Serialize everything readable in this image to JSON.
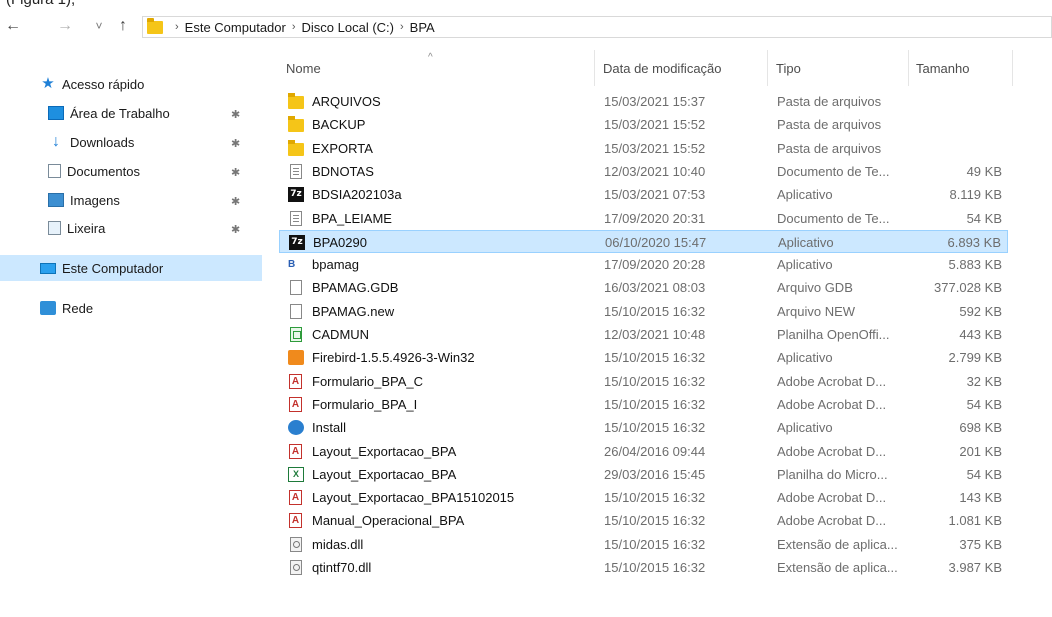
{
  "top_text": "(Figura 1),",
  "nav": {
    "back": "←",
    "forward": "→",
    "recent": "˅",
    "up": "↑",
    "breadcrumb": [
      "Este Computador",
      "Disco Local (C:)",
      "BPA"
    ]
  },
  "sidebar": {
    "items": [
      {
        "label": "Acesso rápido",
        "icon": "star-icon"
      },
      {
        "label": "Área de Trabalho",
        "icon": "desktop-icon",
        "pinned": true
      },
      {
        "label": "Downloads",
        "icon": "download-icon",
        "pinned": true
      },
      {
        "label": "Documentos",
        "icon": "documents-icon",
        "pinned": true
      },
      {
        "label": "Imagens",
        "icon": "images-icon",
        "pinned": true
      },
      {
        "label": "Lixeira",
        "icon": "recycle-bin-icon",
        "pinned": true
      },
      {
        "label": "Este Computador",
        "icon": "computer-icon",
        "selected": true
      },
      {
        "label": "Rede",
        "icon": "network-icon"
      }
    ],
    "pin_glyph": "📌"
  },
  "columns": {
    "name": "Nome",
    "date": "Data de modificação",
    "type": "Tipo",
    "size": "Tamanho",
    "sort_indicator": "^"
  },
  "files": [
    {
      "name": "ARQUIVOS",
      "date": "15/03/2021 15:37",
      "type": "Pasta de arquivos",
      "size": "",
      "icon": "folder-icon"
    },
    {
      "name": "BACKUP",
      "date": "15/03/2021 15:52",
      "type": "Pasta de arquivos",
      "size": "",
      "icon": "folder-icon"
    },
    {
      "name": "EXPORTA",
      "date": "15/03/2021 15:52",
      "type": "Pasta de arquivos",
      "size": "",
      "icon": "folder-icon"
    },
    {
      "name": "BDNOTAS",
      "date": "12/03/2021 10:40",
      "type": "Documento de Te...",
      "size": "49 KB",
      "icon": "text-file-icon"
    },
    {
      "name": "BDSIA202103a",
      "date": "15/03/2021 07:53",
      "type": "Aplicativo",
      "size": "8.119 KB",
      "icon": "7zip-icon"
    },
    {
      "name": "BPA_LEIAME",
      "date": "17/09/2020 20:31",
      "type": "Documento de Te...",
      "size": "54 KB",
      "icon": "text-file-icon"
    },
    {
      "name": "BPA0290",
      "date": "06/10/2020 15:47",
      "type": "Aplicativo",
      "size": "6.893 KB",
      "icon": "7zip-icon",
      "selected": true
    },
    {
      "name": "bpamag",
      "date": "17/09/2020 20:28",
      "type": "Aplicativo",
      "size": "5.883 KB",
      "icon": "bpa-app-icon"
    },
    {
      "name": "BPAMAG.GDB",
      "date": "16/03/2021 08:03",
      "type": "Arquivo GDB",
      "size": "377.028 KB",
      "icon": "blank-file-icon"
    },
    {
      "name": "BPAMAG.new",
      "date": "15/10/2015 16:32",
      "type": "Arquivo NEW",
      "size": "592 KB",
      "icon": "blank-file-icon"
    },
    {
      "name": "CADMUN",
      "date": "12/03/2021 10:48",
      "type": "Planilha OpenOffi...",
      "size": "443 KB",
      "icon": "spreadsheet-icon"
    },
    {
      "name": "Firebird-1.5.5.4926-3-Win32",
      "date": "15/10/2015 16:32",
      "type": "Aplicativo",
      "size": "2.799 KB",
      "icon": "installer-icon"
    },
    {
      "name": "Formulario_BPA_C",
      "date": "15/10/2015 16:32",
      "type": "Adobe Acrobat D...",
      "size": "32 KB",
      "icon": "pdf-icon"
    },
    {
      "name": "Formulario_BPA_I",
      "date": "15/10/2015 16:32",
      "type": "Adobe Acrobat D...",
      "size": "54 KB",
      "icon": "pdf-icon"
    },
    {
      "name": "Install",
      "date": "15/10/2015 16:32",
      "type": "Aplicativo",
      "size": "698 KB",
      "icon": "install-icon"
    },
    {
      "name": "Layout_Exportacao_BPA",
      "date": "26/04/2016 09:44",
      "type": "Adobe Acrobat D...",
      "size": "201 KB",
      "icon": "pdf-icon"
    },
    {
      "name": "Layout_Exportacao_BPA",
      "date": "29/03/2016 15:45",
      "type": "Planilha do Micro...",
      "size": "54 KB",
      "icon": "excel-icon"
    },
    {
      "name": "Layout_Exportacao_BPA15102015",
      "date": "15/10/2015 16:32",
      "type": "Adobe Acrobat D...",
      "size": "143 KB",
      "icon": "pdf-icon"
    },
    {
      "name": "Manual_Operacional_BPA",
      "date": "15/10/2015 16:32",
      "type": "Adobe Acrobat D...",
      "size": "1.081 KB",
      "icon": "pdf-icon"
    },
    {
      "name": "midas.dll",
      "date": "15/10/2015 16:32",
      "type": "Extensão de aplica...",
      "size": "375 KB",
      "icon": "dll-icon"
    },
    {
      "name": "qtintf70.dll",
      "date": "15/10/2015 16:32",
      "type": "Extensão de aplica...",
      "size": "3.987 KB",
      "icon": "dll-icon"
    }
  ]
}
